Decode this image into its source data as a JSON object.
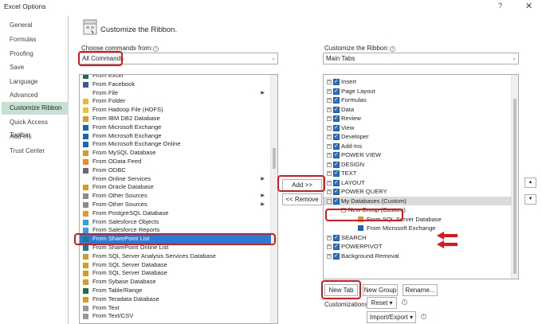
{
  "window": {
    "title": "Excel Options",
    "help": "?",
    "close": "✕"
  },
  "sidebar": {
    "items": [
      {
        "label": "General",
        "selected": false
      },
      {
        "label": "Formulas",
        "selected": false
      },
      {
        "label": "Proofing",
        "selected": false
      },
      {
        "label": "Save",
        "selected": false
      },
      {
        "label": "Language",
        "selected": false
      },
      {
        "label": "Advanced",
        "selected": false
      },
      {
        "label": "Customize Ribbon",
        "selected": true
      },
      {
        "label": "Quick Access Toolbar",
        "selected": false
      },
      {
        "label": "Add-Ins",
        "selected": false
      },
      {
        "label": "Trust Center",
        "selected": false
      }
    ]
  },
  "header": {
    "title": "Customize the Ribbon."
  },
  "left": {
    "label": "Choose commands from:",
    "combo_value": "All Commands",
    "commands": [
      {
        "label": "From Excel",
        "icon": "excel-icon",
        "submenu": false
      },
      {
        "label": "From Facebook",
        "icon": "facebook-icon",
        "submenu": false
      },
      {
        "label": "From File",
        "icon": "none",
        "submenu": true
      },
      {
        "label": "From Folder",
        "icon": "folder-icon",
        "submenu": false
      },
      {
        "label": "From Hadoop File (HDFS)",
        "icon": "hadoop-icon",
        "submenu": false
      },
      {
        "label": "From IBM DB2 Database",
        "icon": "database-icon",
        "submenu": false
      },
      {
        "label": "From Microsoft Exchange",
        "icon": "exchange-icon",
        "submenu": false
      },
      {
        "label": "From Microsoft Exchange",
        "icon": "exchange-icon",
        "submenu": false
      },
      {
        "label": "From Microsoft Exchange Online",
        "icon": "exchange-icon",
        "submenu": false
      },
      {
        "label": "From MySQL Database",
        "icon": "database-icon",
        "submenu": false
      },
      {
        "label": "From OData Feed",
        "icon": "odata-icon",
        "submenu": false
      },
      {
        "label": "From ODBC",
        "icon": "odbc-icon",
        "submenu": false
      },
      {
        "label": "From Online Services",
        "icon": "none",
        "submenu": true
      },
      {
        "label": "From Oracle Database",
        "icon": "database-icon",
        "submenu": false
      },
      {
        "label": "From Other Sources",
        "icon": "other-sources-icon",
        "submenu": true
      },
      {
        "label": "From Other Sources",
        "icon": "other-sources-icon",
        "submenu": true
      },
      {
        "label": "From PostgreSQL Database",
        "icon": "database-icon",
        "submenu": false
      },
      {
        "label": "From Salesforce Objects",
        "icon": "salesforce-icon",
        "submenu": false
      },
      {
        "label": "From Salesforce Reports",
        "icon": "salesforce-icon",
        "submenu": false
      },
      {
        "label": "From SharePoint List",
        "icon": "sharepoint-icon",
        "submenu": false,
        "selected": true
      },
      {
        "label": "From SharePoint Online List",
        "icon": "sharepoint-icon",
        "submenu": false
      },
      {
        "label": "From SQL Server Analysis Services Database",
        "icon": "database-icon",
        "submenu": false
      },
      {
        "label": "From SQL Server Database",
        "icon": "database-icon",
        "submenu": false
      },
      {
        "label": "From SQL Server Database",
        "icon": "database-icon",
        "submenu": false
      },
      {
        "label": "From Sybase Database",
        "icon": "database-icon",
        "submenu": false
      },
      {
        "label": "From Table/Range",
        "icon": "table-icon",
        "submenu": false
      },
      {
        "label": "From Teradata Database",
        "icon": "database-icon",
        "submenu": false
      },
      {
        "label": "From Text",
        "icon": "text-file-icon",
        "submenu": false
      },
      {
        "label": "From Text/CSV",
        "icon": "text-file-icon",
        "submenu": false
      }
    ]
  },
  "middle": {
    "add_label": "Add >>",
    "remove_label": "<< Remove"
  },
  "right": {
    "label": "Customize the Ribbon:",
    "combo_value": "Main Tabs",
    "tabs": [
      {
        "label": "Insert",
        "kind": "tab"
      },
      {
        "label": "Page Layout",
        "kind": "tab"
      },
      {
        "label": "Formulas",
        "kind": "tab"
      },
      {
        "label": "Data",
        "kind": "tab"
      },
      {
        "label": "Review",
        "kind": "tab"
      },
      {
        "label": "View",
        "kind": "tab"
      },
      {
        "label": "Developer",
        "kind": "tab"
      },
      {
        "label": "Add-Ins",
        "kind": "tab"
      },
      {
        "label": "POWER VIEW",
        "kind": "tab"
      },
      {
        "label": "DESIGN",
        "kind": "tab"
      },
      {
        "label": "TEXT",
        "kind": "tab"
      },
      {
        "label": "LAYOUT",
        "kind": "tab"
      },
      {
        "label": "POWER QUERY",
        "kind": "tab"
      },
      {
        "label": "My Databases (Custom)",
        "kind": "tab-expanded"
      },
      {
        "label": "New Group (Custom)",
        "kind": "group"
      },
      {
        "label": "From SQL Server Database",
        "kind": "command"
      },
      {
        "label": "From Microsoft Exchange",
        "kind": "command"
      },
      {
        "label": "SEARCH",
        "kind": "tab"
      },
      {
        "label": "POWERPIVOT",
        "kind": "tab"
      },
      {
        "label": "Background Removal",
        "kind": "tab"
      }
    ],
    "new_tab_label": "New Tab",
    "new_group_label": "New Group",
    "rename_label": "Rename...",
    "customizations_label": "Customizations:",
    "reset_label": "Reset ▾",
    "import_export_label": "Import/Export ▾"
  },
  "colors": {
    "accent": "#2a7bd5",
    "sidebar_selected": "#c6e0d2",
    "annotation": "#e0161c",
    "checkbox": "#2b6fc0"
  }
}
